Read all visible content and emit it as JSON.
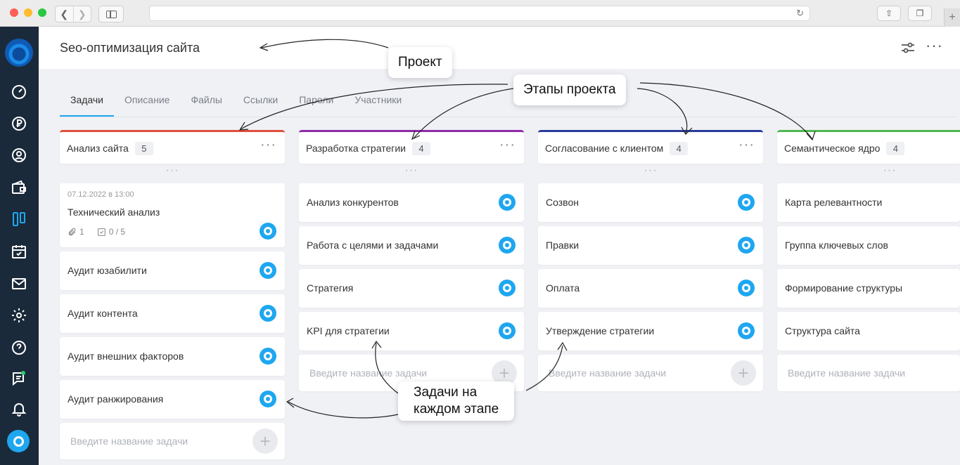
{
  "project": {
    "title": "Seo-оптимизация сайта"
  },
  "tabs": [
    {
      "label": "Задачи",
      "active": true
    },
    {
      "label": "Описание"
    },
    {
      "label": "Файлы"
    },
    {
      "label": "Ссылки"
    },
    {
      "label": "Пароли"
    },
    {
      "label": "Участники"
    }
  ],
  "columns": [
    {
      "name": "Анализ сайта",
      "count": "5",
      "color": "#e04e3c",
      "first_card": {
        "date": "07.12.2022 в 13:00",
        "title": "Технический анализ",
        "attachments": "1",
        "checklist": "0 / 5"
      },
      "cards": [
        "Аудит юзабилити",
        "Аудит контента",
        "Аудит внешних факторов",
        "Аудит ранжирования"
      ]
    },
    {
      "name": "Разработка стратегии",
      "count": "4",
      "color": "#8e2ba8",
      "cards": [
        "Анализ конкурентов",
        "Работа с целями и задачами",
        "Стратегия",
        "KPI для стратегии"
      ]
    },
    {
      "name": "Согласование с клиентом",
      "count": "4",
      "color": "#283b9c",
      "cards": [
        "Созвон",
        "Правки",
        "Оплата",
        "Утверждение стратегии"
      ]
    },
    {
      "name": "Семантическое ядро",
      "count": "4",
      "color": "#4cb84f",
      "cards": [
        "Карта релевантности",
        "Группа ключевых слов",
        "Формирование структуры",
        "Структура сайта"
      ]
    }
  ],
  "new_task_placeholder": "Введите название задачи",
  "annotations": {
    "project": "Проект",
    "stages": "Этапы проекта",
    "tasks_line1": "Задачи на",
    "tasks_line2": "каждом этапе"
  }
}
